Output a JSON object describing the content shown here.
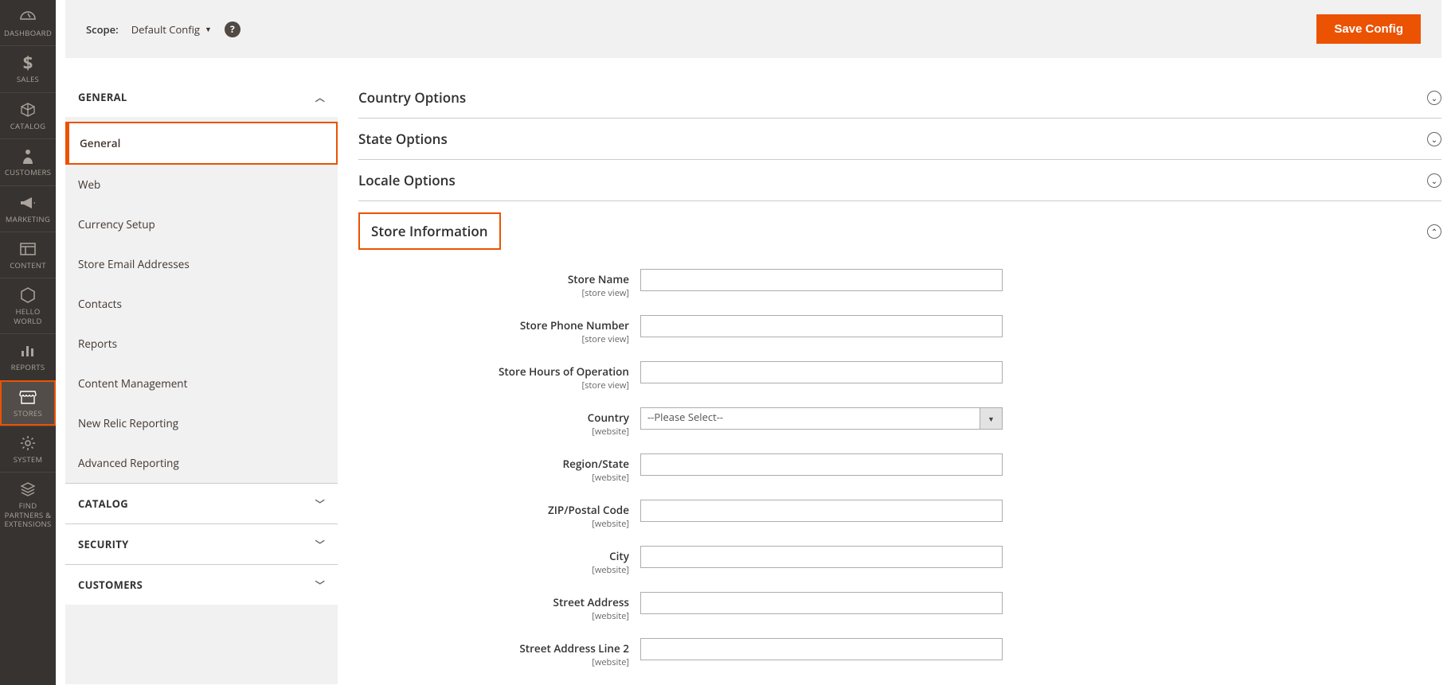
{
  "sidebar": {
    "items": [
      {
        "label": "DASHBOARD",
        "icon": "gauge"
      },
      {
        "label": "SALES",
        "icon": "dollar"
      },
      {
        "label": "CATALOG",
        "icon": "box"
      },
      {
        "label": "CUSTOMERS",
        "icon": "person"
      },
      {
        "label": "MARKETING",
        "icon": "megaphone"
      },
      {
        "label": "CONTENT",
        "icon": "layout"
      },
      {
        "label": "HELLO WORLD",
        "icon": "hex"
      },
      {
        "label": "REPORTS",
        "icon": "bars"
      },
      {
        "label": "STORES",
        "icon": "store",
        "active": true
      },
      {
        "label": "SYSTEM",
        "icon": "gear"
      },
      {
        "label": "FIND PARTNERS & EXTENSIONS",
        "icon": "stack"
      }
    ]
  },
  "scope": {
    "label": "Scope:",
    "value": "Default Config"
  },
  "save_button": "Save Config",
  "nav": {
    "groups": [
      {
        "title": "GENERAL",
        "expanded": true,
        "items": [
          "General",
          "Web",
          "Currency Setup",
          "Store Email Addresses",
          "Contacts",
          "Reports",
          "Content Management",
          "New Relic Reporting",
          "Advanced Reporting"
        ],
        "activeIndex": 0
      },
      {
        "title": "CATALOG",
        "expanded": false
      },
      {
        "title": "SECURITY",
        "expanded": false
      },
      {
        "title": "CUSTOMERS",
        "expanded": false
      }
    ]
  },
  "sections": {
    "country": "Country Options",
    "state": "State Options",
    "locale": "Locale Options",
    "store_info": "Store Information"
  },
  "form": {
    "store_name": {
      "label": "Store Name",
      "scope": "[store view]"
    },
    "store_phone": {
      "label": "Store Phone Number",
      "scope": "[store view]"
    },
    "store_hours": {
      "label": "Store Hours of Operation",
      "scope": "[store view]"
    },
    "country": {
      "label": "Country",
      "scope": "[website]",
      "placeholder": "--Please Select--"
    },
    "region": {
      "label": "Region/State",
      "scope": "[website]"
    },
    "zip": {
      "label": "ZIP/Postal Code",
      "scope": "[website]"
    },
    "city": {
      "label": "City",
      "scope": "[website]"
    },
    "street1": {
      "label": "Street Address",
      "scope": "[website]"
    },
    "street2": {
      "label": "Street Address Line 2",
      "scope": "[website]"
    }
  }
}
